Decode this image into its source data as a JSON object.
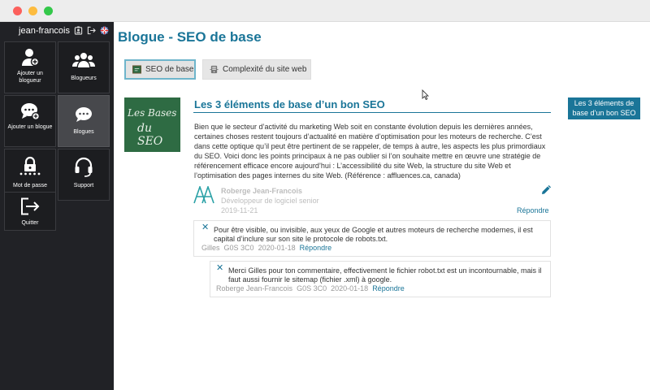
{
  "window": {
    "controls": [
      "close",
      "minimize",
      "maximize"
    ]
  },
  "user": {
    "name": "jean-francois"
  },
  "userbar_icons": [
    "badge-icon",
    "logout-icon",
    "uk-flag-icon"
  ],
  "nav": {
    "tiles": [
      {
        "label": "Ajouter un blogueur",
        "icon": "add-user-icon",
        "active": false
      },
      {
        "label": "Blogueurs",
        "icon": "users-icon",
        "active": false
      },
      {
        "label": "Ajouter un blogue",
        "icon": "add-comment-icon",
        "active": false
      },
      {
        "label": "Blogues",
        "icon": "comments-icon",
        "active": true
      },
      {
        "label": "Mot de passe",
        "icon": "lock-icon",
        "active": false
      },
      {
        "label": "Support",
        "icon": "headset-icon",
        "active": false
      },
      {
        "label": "Quitter",
        "icon": "exit-icon",
        "active": false
      }
    ]
  },
  "page": {
    "title": "Blogue - SEO de base"
  },
  "tabs": [
    {
      "label": "SEO de base",
      "icon": "blackboard-icon",
      "selected": true
    },
    {
      "label": "Complexité du site web",
      "icon": "server-icon",
      "selected": false
    }
  ],
  "post": {
    "thumbnail_text_1": "Les Bases",
    "thumbnail_text_2": "du SEO",
    "title": "Les 3 éléments de base d’un bon SEO",
    "body": "Bien que le secteur d’activité du marketing Web soit en constante évolution depuis les dernières années, certaines choses restent toujours d’actualité en matière d’optimisation pour les moteurs de recherche. C’est dans cette optique qu’il peut être pertinent de se rappeler, de temps à autre, les aspects les plus primordiaux du SEO. Voici donc les points principaux à ne pas oublier si l’on souhaite mettre en œuvre une stratégie de référencement efficace encore aujourd’hui : L’accessibilité du site Web, la structure du site Web et l’optimisation des pages internes du site Web. (Référence : affluences.ca, canada)",
    "author_name": "Roberge Jean-Francois",
    "author_role": "Développeur de logiciel senior",
    "date": "2019-11-21",
    "reply_label": "Répondre"
  },
  "comments": [
    {
      "text": "Pour être visible, ou invisible, aux yeux de Google et autres moteurs de recherche modernes, il est capital d’inclure sur son site le protocole de robots.txt.",
      "author": "Gilles",
      "postal": "G0S 3C0",
      "date": "2020-01-18",
      "reply_label": "Répondre"
    },
    {
      "text": "Merci Gilles pour ton commentaire, effectivement le fichier robot.txt est un incontournable, mais il faut aussi fournir le sitemap (fichier .xml) à google.",
      "author": "Roberge Jean-Francois",
      "postal": "G0S 3C0",
      "date": "2020-01-18",
      "reply_label": "Répondre"
    }
  ],
  "side_badge": {
    "line1": "Les 3 éléments de",
    "line2": "base d’un bon SEO"
  },
  "colors": {
    "accent": "#1a7598",
    "sidebar": "#212226",
    "tile_active": "#47484c"
  }
}
